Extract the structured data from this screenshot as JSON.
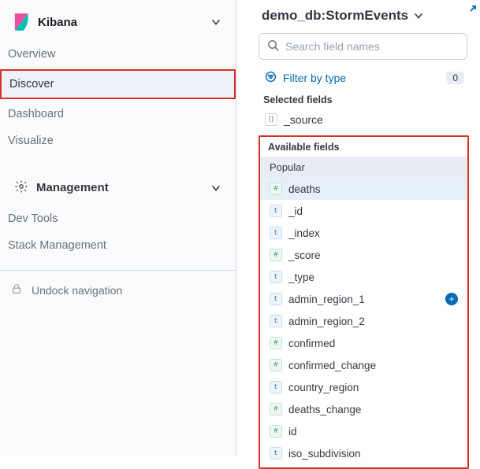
{
  "sidebar": {
    "brand": "Kibana",
    "nav": [
      {
        "label": "Overview",
        "active": false,
        "highlighted": false
      },
      {
        "label": "Discover",
        "active": true,
        "highlighted": true
      },
      {
        "label": "Dashboard",
        "active": false,
        "highlighted": false
      },
      {
        "label": "Visualize",
        "active": false,
        "highlighted": false
      }
    ],
    "management_heading": "Management",
    "management_items": [
      {
        "label": "Dev Tools"
      },
      {
        "label": "Stack Management"
      }
    ],
    "undock_label": "Undock navigation"
  },
  "field_panel": {
    "dataset": "demo_db:StormEvents",
    "search_placeholder": "Search field names",
    "filter_label": "Filter by type",
    "filter_count": "0",
    "selected_heading": "Selected fields",
    "selected_fields": [
      {
        "label": "_source",
        "type": "src"
      }
    ],
    "available_heading": "Available fields",
    "popular_heading": "Popular",
    "popular_fields": [
      {
        "label": "deaths",
        "type": "num"
      }
    ],
    "fields": [
      {
        "label": "_id",
        "type": "txt",
        "add": false
      },
      {
        "label": "_index",
        "type": "txt",
        "add": false
      },
      {
        "label": "_score",
        "type": "num",
        "add": false
      },
      {
        "label": "_type",
        "type": "txt",
        "add": false
      },
      {
        "label": "admin_region_1",
        "type": "txt",
        "add": true
      },
      {
        "label": "admin_region_2",
        "type": "txt",
        "add": false
      },
      {
        "label": "confirmed",
        "type": "num",
        "add": false
      },
      {
        "label": "confirmed_change",
        "type": "num",
        "add": false
      },
      {
        "label": "country_region",
        "type": "txt",
        "add": false
      },
      {
        "label": "deaths_change",
        "type": "num",
        "add": false
      },
      {
        "label": "id",
        "type": "num",
        "add": false
      },
      {
        "label": "iso_subdivision",
        "type": "txt",
        "add": false
      }
    ]
  }
}
